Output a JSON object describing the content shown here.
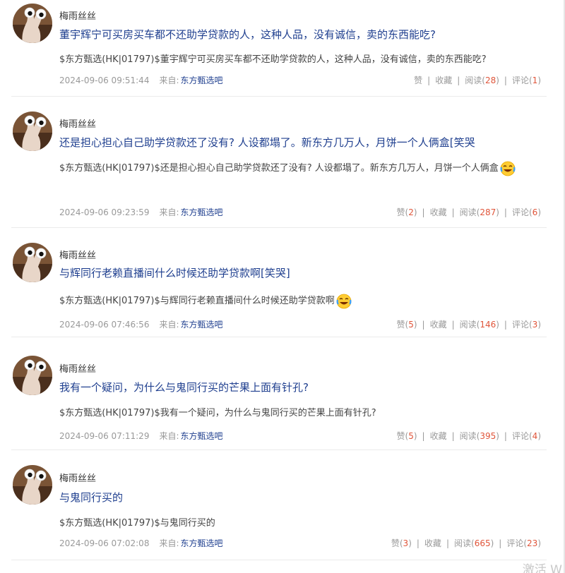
{
  "posts": [
    {
      "author": "梅雨丝丝",
      "title": "董宇辉宁可买房买车都不还助学贷款的人，这种人品，没有诚信，卖的东西能吃?",
      "body": "$东方甄选(HK|01797)$董宇辉宁可买房买车都不还助学贷款的人，这种人品，没有诚信，卖的东西能吃?",
      "has_emoji": false,
      "time": "2024-09-06 09:51:44",
      "source_label": "来自:",
      "source": "东方甄选吧",
      "like_label": "赞",
      "like_count": "",
      "fav_label": "收藏",
      "read_label": "阅读",
      "read_count": "28",
      "comment_label": "评论",
      "comment_count": "1"
    },
    {
      "author": "梅雨丝丝",
      "title": "还是担心担心自己助学贷款还了没有? 人设都塌了。新东方几万人，月饼一个人俩盒[笑哭",
      "body": "$东方甄选(HK|01797)$还是担心担心自己助学贷款还了没有? 人设都塌了。新东方几万人，月饼一个人俩盒",
      "has_emoji": true,
      "time": "2024-09-06 09:23:59",
      "source_label": "来自:",
      "source": "东方甄选吧",
      "like_label": "赞",
      "like_count": "2",
      "fav_label": "收藏",
      "read_label": "阅读",
      "read_count": "287",
      "comment_label": "评论",
      "comment_count": "6"
    },
    {
      "author": "梅雨丝丝",
      "title": "与辉同行老赖直播间什么时候还助学贷款啊[笑哭]",
      "body": "$东方甄选(HK|01797)$与辉同行老赖直播间什么时候还助学贷款啊",
      "has_emoji": true,
      "time": "2024-09-06 07:46:56",
      "source_label": "来自:",
      "source": "东方甄选吧",
      "like_label": "赞",
      "like_count": "5",
      "fav_label": "收藏",
      "read_label": "阅读",
      "read_count": "146",
      "comment_label": "评论",
      "comment_count": "3"
    },
    {
      "author": "梅雨丝丝",
      "title": "我有一个疑问，为什么与鬼同行买的芒果上面有针孔?",
      "body": "$东方甄选(HK|01797)$我有一个疑问，为什么与鬼同行买的芒果上面有针孔?",
      "has_emoji": false,
      "time": "2024-09-06 07:11:29",
      "source_label": "来自:",
      "source": "东方甄选吧",
      "like_label": "赞",
      "like_count": "5",
      "fav_label": "收藏",
      "read_label": "阅读",
      "read_count": "395",
      "comment_label": "评论",
      "comment_count": "4"
    },
    {
      "author": "梅雨丝丝",
      "title": "与鬼同行买的",
      "body": "$东方甄选(HK|01797)$与鬼同行买的",
      "has_emoji": false,
      "time": "2024-09-06 07:02:08",
      "source_label": "来自:",
      "source": "东方甄选吧",
      "like_label": "赞",
      "like_count": "3",
      "fav_label": "收藏",
      "read_label": "阅读",
      "read_count": "665",
      "comment_label": "评论",
      "comment_count": "23"
    }
  ],
  "corner_text": "激活 W"
}
